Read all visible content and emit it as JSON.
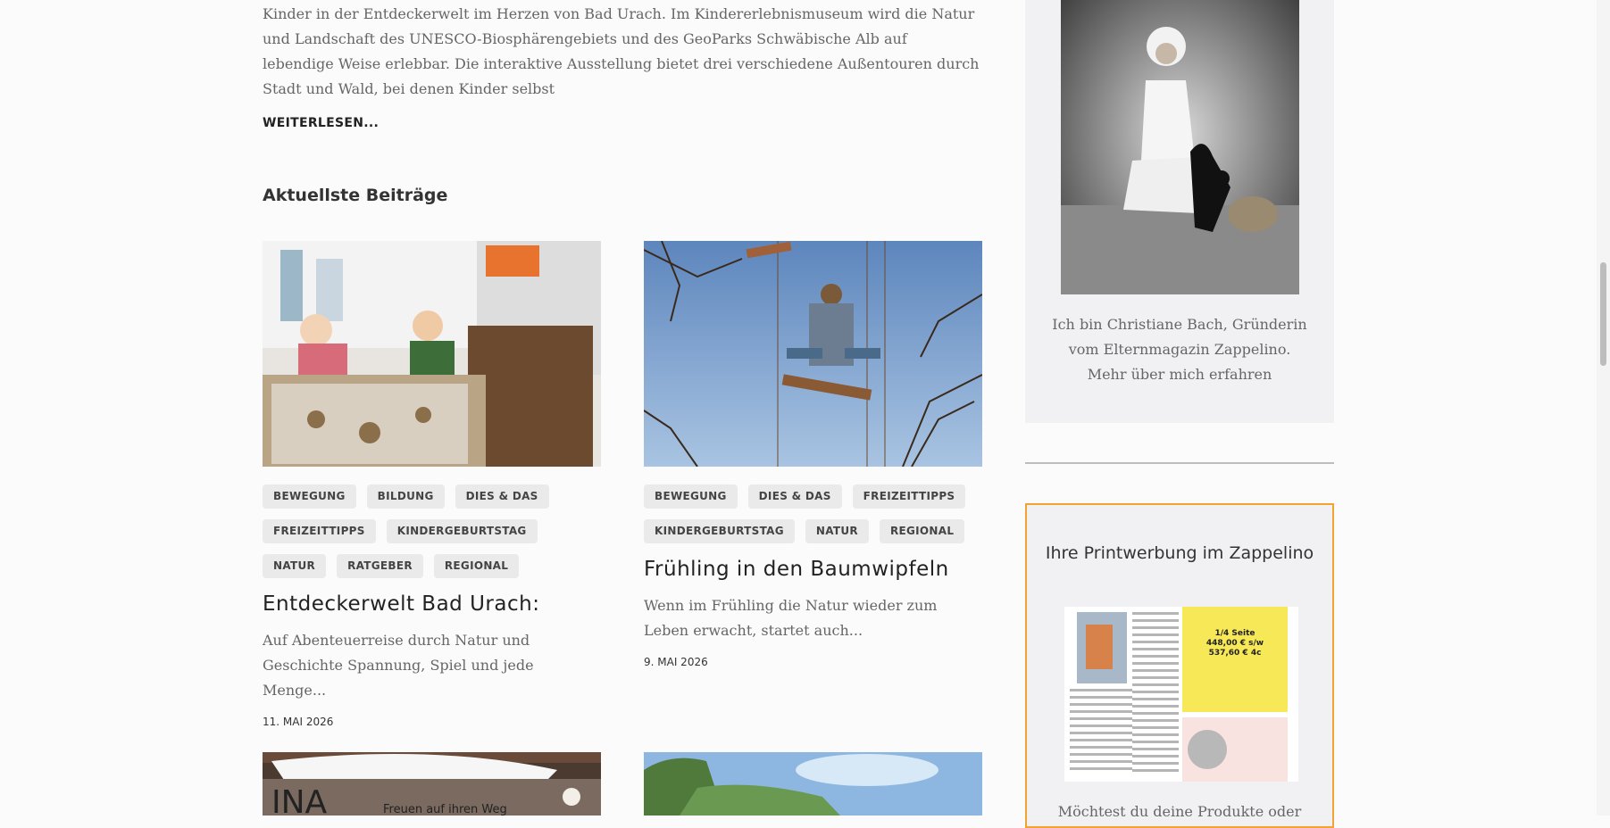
{
  "intro": {
    "text": "Kinder in der Entdeckerwelt im Herzen von Bad Urach. Im Kindererlebnismuseum wird die Natur und Landschaft des UNESCO-Biosphärengebiets und des GeoParks Schwäbische Alb auf lebendige Weise erlebbar. Die interaktive Ausstellung bietet drei verschiedene Außentouren durch Stadt und Wald, bei denen Kinder selbst",
    "readmore": "WEITERLESEN..."
  },
  "section_title": "Aktuellste Beiträge",
  "posts": [
    {
      "tags": [
        "BEWEGUNG",
        "BILDUNG",
        "DIES & DAS",
        "FREIZEITTIPPS",
        "KINDERGEBURTSTAG",
        "NATUR",
        "RATGEBER",
        "REGIONAL"
      ],
      "title": "Entdeckerwelt Bad Urach:",
      "excerpt": "Auf Abenteuerreise durch Natur und Geschichte Spannung, Spiel und jede Menge...",
      "date": "11. MAI 2026"
    },
    {
      "tags": [
        "BEWEGUNG",
        "DIES & DAS",
        "FREIZEITTIPPS",
        "KINDERGEBURTSTAG",
        "NATUR",
        "REGIONAL"
      ],
      "title": "Frühling in den Baumwipfeln",
      "excerpt": "Wenn im Frühling die Natur wieder zum Leben erwacht, startet auch...",
      "date": "9. MAI 2026"
    }
  ],
  "next_posts": {
    "post3_banner": "Freuen auf ihren Weg"
  },
  "sidebar": {
    "profile_line1": "Ich bin Christiane Bach, Gründerin",
    "profile_line2": "vom Elternmagazin Zappelino.",
    "profile_link": "Mehr über mich erfahren",
    "ad_title": "Ihre Printwerbung im Zappelino",
    "ad_size": "1/4 Seite",
    "ad_price_bw": "448,00 € s/w",
    "ad_price_color": "537,60 € 4c",
    "ad_text": "Möchtest du deine Produkte oder"
  },
  "colors": {
    "accent_border": "#f2a332",
    "tag_bg": "#eaeaea"
  }
}
